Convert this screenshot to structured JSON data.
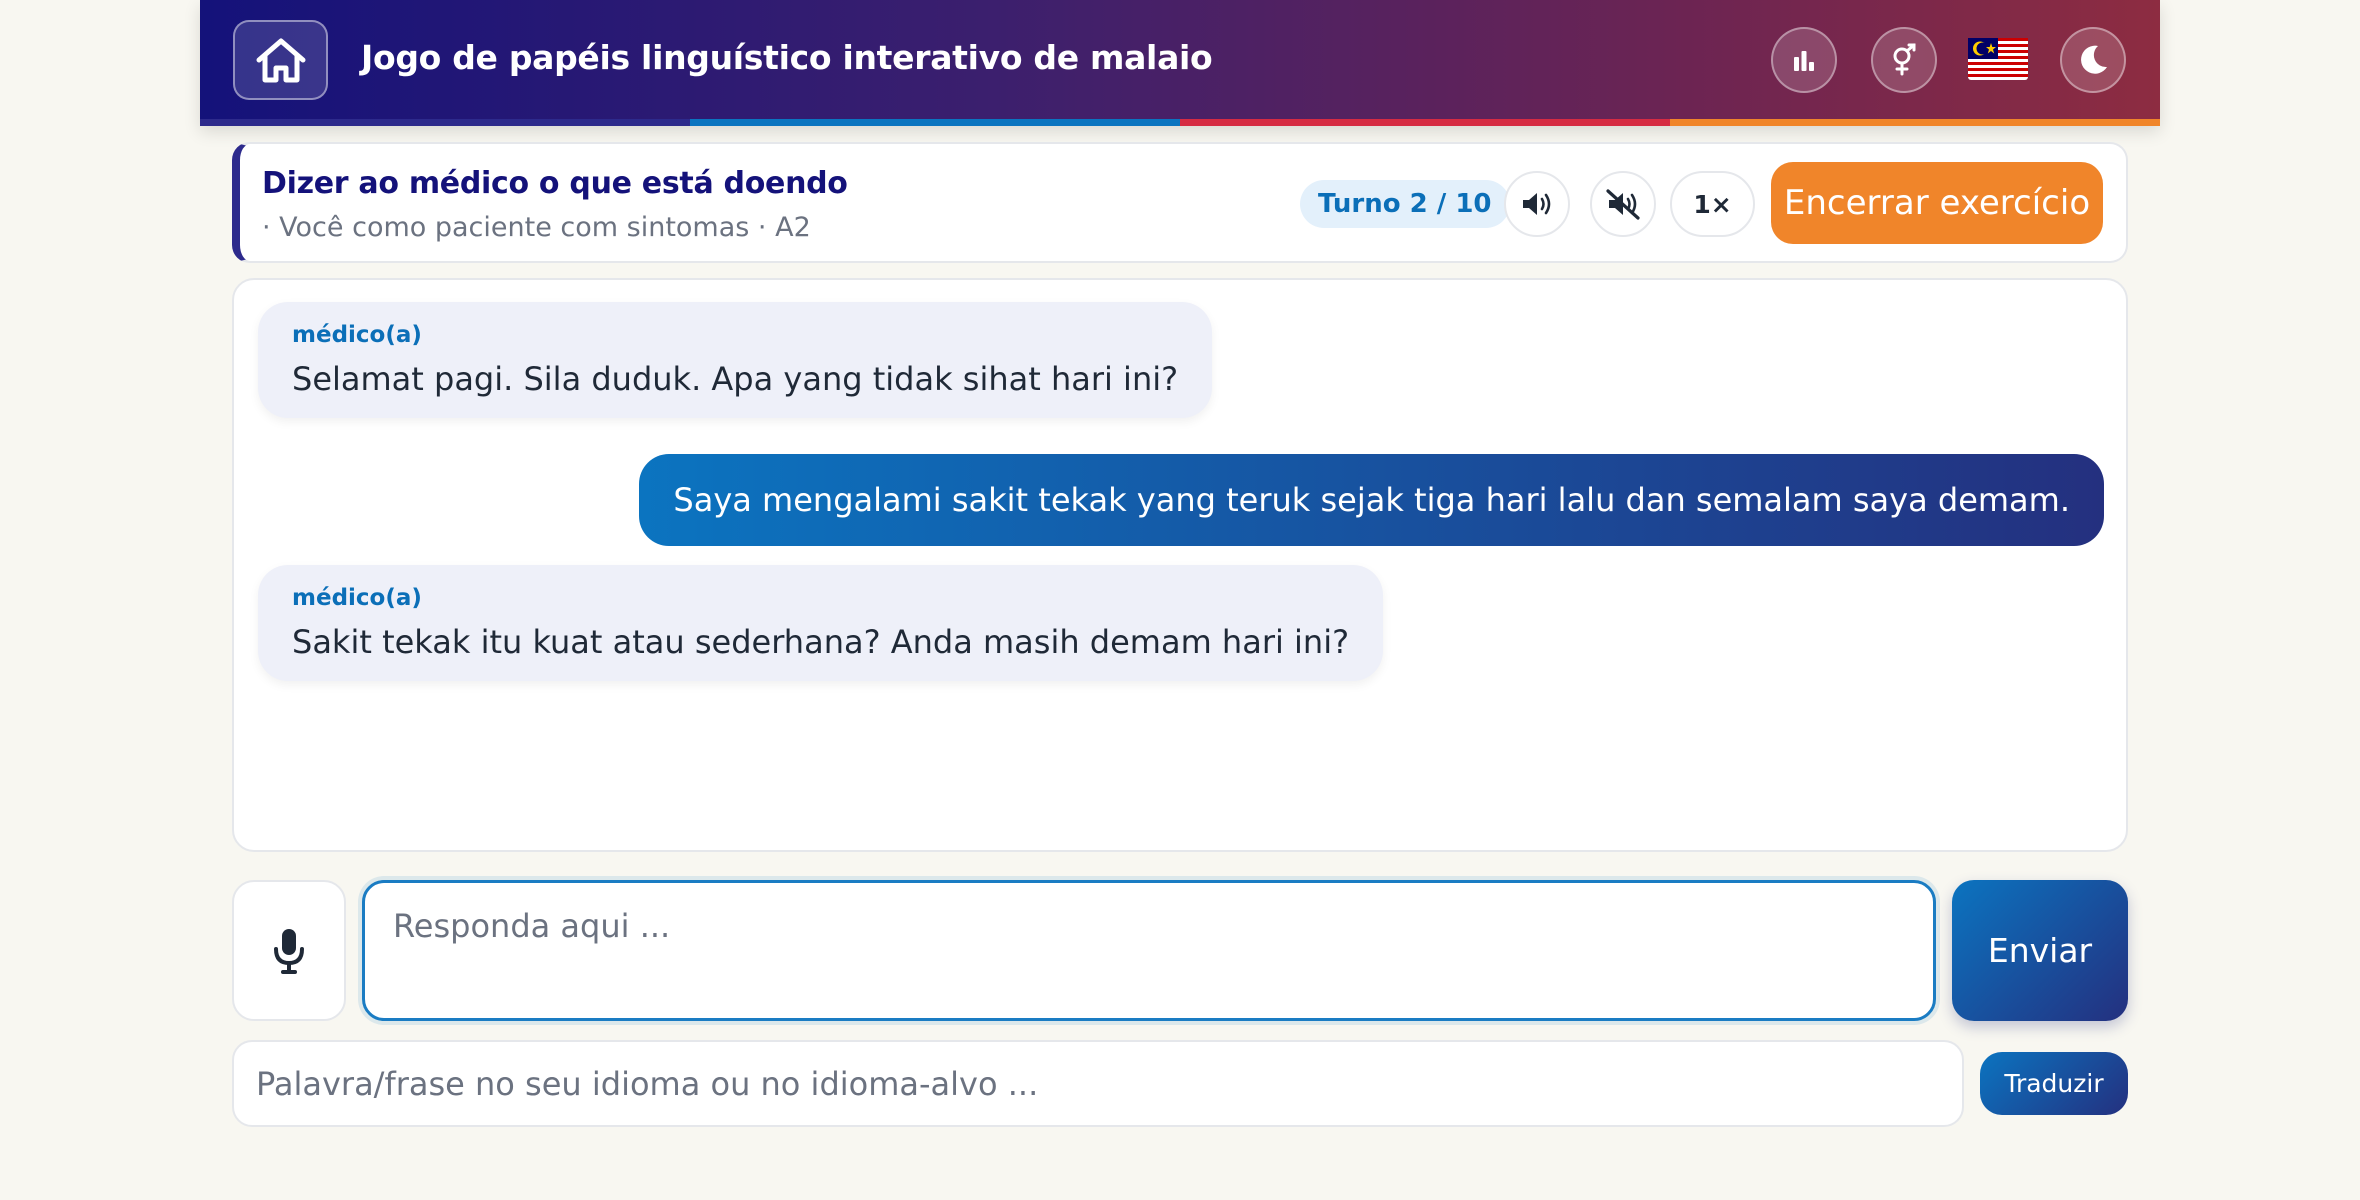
{
  "header": {
    "title": "Jogo de papéis linguístico interativo de malaio",
    "icons": [
      "home-icon",
      "bar-chart-icon",
      "gender-icon",
      "malaysia-flag-icon",
      "moon-icon"
    ],
    "stripe_colors": [
      "#2d2a8c",
      "#0b74c0",
      "#d62b43",
      "#f0852a"
    ]
  },
  "exercise": {
    "title": "Dizer ao médico o que está doendo",
    "subtitle": "· Você como paciente com sintomas · A2",
    "turn_label": "Turno 2 / 10",
    "speed_label": "1×",
    "end_label": "Encerrar exercício"
  },
  "chat": {
    "messages": [
      {
        "role": "partner",
        "speaker": "médico(a)",
        "text": "Selamat pagi. Sila duduk. Apa yang tidak sihat hari ini?"
      },
      {
        "role": "user",
        "text": "Saya mengalami sakit tekak yang teruk sejak tiga hari lalu dan semalam saya demam."
      },
      {
        "role": "partner",
        "speaker": "médico(a)",
        "text": "Sakit tekak itu kuat atau sederhana? Anda masih demam hari ini?"
      }
    ]
  },
  "input": {
    "reply_placeholder": "Responda aqui ...",
    "send_label": "Enviar",
    "translate_placeholder": "Palavra/frase no seu idioma ou no idioma-alvo ...",
    "translate_label": "Traduzir"
  },
  "colors": {
    "accent_blue": "#0b74c0",
    "accent_navy": "#24307f",
    "accent_orange": "#f0852a",
    "background": "#f8f7f1"
  }
}
